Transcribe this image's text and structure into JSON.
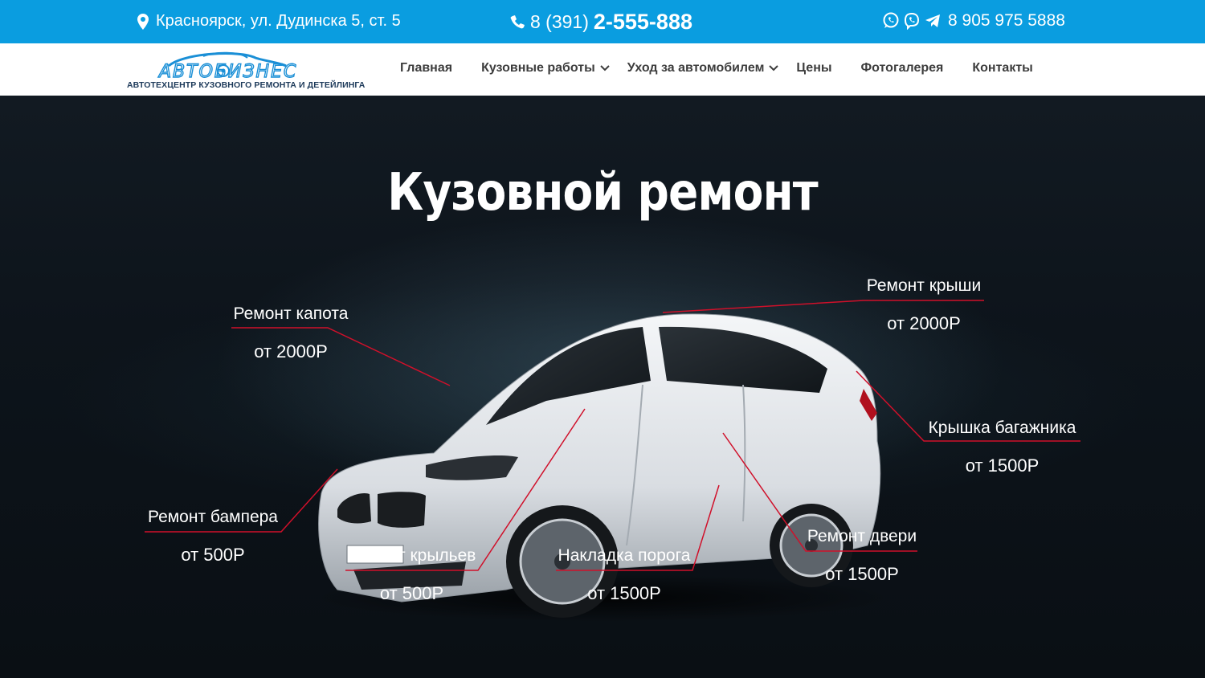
{
  "topbar": {
    "address": "Красноярск, ул. Дудинска 5, ст. 5",
    "phone_prefix": "8 (391)",
    "phone_main": "2-555-888",
    "mobile": "8 905 975 5888",
    "icons": [
      "map-pin-icon",
      "phone-icon",
      "whatsapp-icon",
      "viber-icon",
      "telegram-icon"
    ],
    "bg_color": "#0a9de0"
  },
  "header": {
    "logo_text": "АВТОБИЗНЕС",
    "logo_tagline": "АВТОТЕХЦЕНТР КУЗОВНОГО РЕМОНТА И ДЕТЕЙЛИНГА",
    "nav": [
      {
        "label": "Главная",
        "dropdown": false
      },
      {
        "label": "Кузовные работы",
        "dropdown": true
      },
      {
        "label": "Уход за автомобилем",
        "dropdown": true
      },
      {
        "label": "Цены",
        "dropdown": false
      },
      {
        "label": "Фотогалерея",
        "dropdown": false
      },
      {
        "label": "Контакты",
        "dropdown": false
      }
    ]
  },
  "hero": {
    "title": "Кузовной ремонт",
    "accent_color": "#d0102a",
    "services": [
      {
        "name": "Ремонт капота",
        "price": "от 2000Р"
      },
      {
        "name": "Ремонт крыши",
        "price": "от 2000Р"
      },
      {
        "name": "Крышка багажника",
        "price": "от 1500Р"
      },
      {
        "name": "Ремонт бампера",
        "price": "от 500Р"
      },
      {
        "name": "Ремонт крыльев",
        "price": "от 500Р"
      },
      {
        "name": "Накладка порога",
        "price": "от 1500Р"
      },
      {
        "name": "Ремонт двери",
        "price": "от 1500Р"
      }
    ]
  }
}
